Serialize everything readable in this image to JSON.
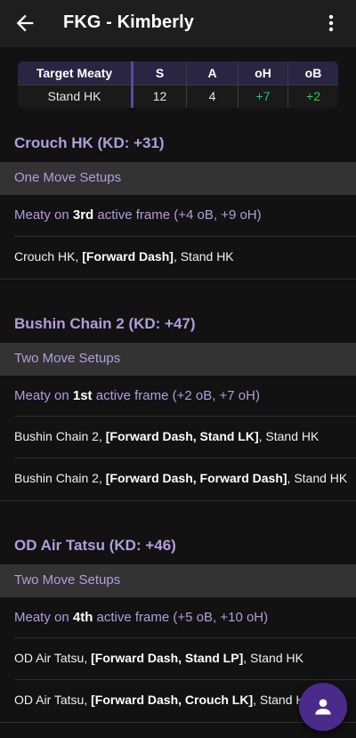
{
  "app_bar": {
    "title": "FKG - Kimberly"
  },
  "frame_table": {
    "headers": [
      "Target Meaty",
      "S",
      "A",
      "oH",
      "oB"
    ],
    "row": [
      "Stand HK",
      "12",
      "4",
      "+7",
      "+2"
    ]
  },
  "sections": [
    {
      "title": "Crouch HK (KD: +31)",
      "setup_label": "One Move Setups",
      "meaty_prefix": "Meaty on ",
      "meaty_frame": "3rd",
      "meaty_suffix": " active frame (+4 oB, +9 oH)",
      "combos": [
        {
          "start": "Crouch HK, ",
          "bold": "[Forward Dash]",
          "end": ", Stand HK"
        }
      ]
    },
    {
      "title": "Bushin Chain 2 (KD: +47)",
      "setup_label": "Two Move Setups",
      "meaty_prefix": "Meaty on ",
      "meaty_frame": "1st",
      "meaty_suffix": " active frame (+2 oB, +7 oH)",
      "combos": [
        {
          "start": "Bushin Chain 2, ",
          "bold": "[Forward Dash, Stand LK]",
          "end": ", Stand HK"
        },
        {
          "start": "Bushin Chain 2, ",
          "bold": "[Forward Dash, Forward Dash]",
          "end": ", Stand HK"
        }
      ]
    },
    {
      "title": "OD Air Tatsu (KD: +46)",
      "setup_label": "Two Move Setups",
      "meaty_prefix": "Meaty on ",
      "meaty_frame": "4th",
      "meaty_suffix": " active frame (+5 oB, +10 oH)",
      "combos": [
        {
          "start": "OD Air Tatsu, ",
          "bold": "[Forward Dash, Stand LP]",
          "end": ", Stand HK"
        },
        {
          "start": "OD Air Tatsu, ",
          "bold": "[Forward Dash, Crouch LK]",
          "end": ", Stand HK"
        }
      ]
    }
  ],
  "colors": {
    "accent": "#b39ddb",
    "fab": "#4a2a8a",
    "positive_oh": "#1fbf8f",
    "positive_ob": "#22d04a"
  },
  "icons": {
    "back": "arrow-back-icon",
    "more": "more-vert-icon",
    "fab": "person-icon"
  }
}
